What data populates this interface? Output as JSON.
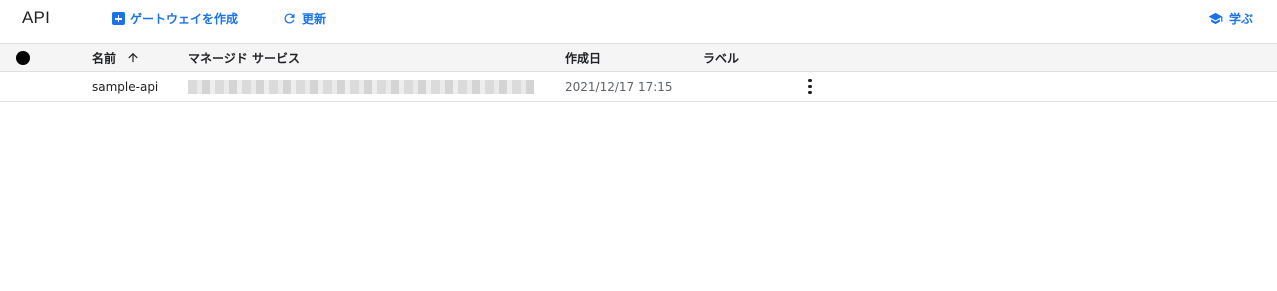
{
  "header": {
    "title": "API",
    "create_gateway_label": "ゲートウェイを作成",
    "refresh_label": "更新",
    "learn_label": "学ぶ"
  },
  "table": {
    "columns": {
      "name": "名前",
      "managed_service": "マネージド サービス",
      "created": "作成日",
      "labels": "ラベル"
    },
    "sort": {
      "column": "name",
      "direction": "ascending"
    },
    "rows": [
      {
        "name": "sample-api",
        "managed_service": "",
        "created": "2021/12/17 17:15",
        "labels": ""
      }
    ]
  },
  "colors": {
    "accent": "#1a73e8",
    "header_bg": "#f5f5f5",
    "border": "#e0e0e0"
  },
  "icons": {
    "create": "add-box-icon",
    "refresh": "refresh-icon",
    "learn": "school-icon",
    "status_column": "status-circle-icon",
    "sort": "arrow-upward-icon",
    "row_menu": "more-vert-icon"
  }
}
